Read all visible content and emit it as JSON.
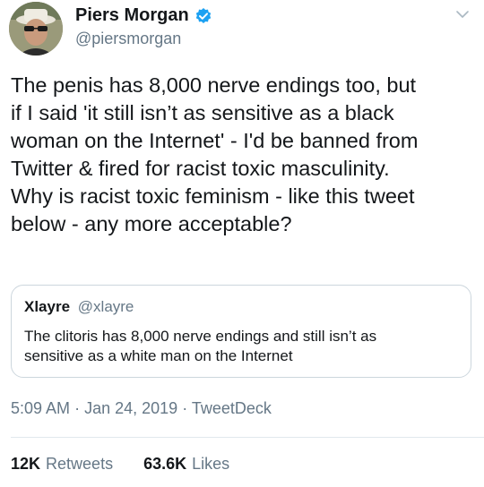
{
  "author": {
    "display_name": "Piers Morgan",
    "handle": "@piersmorgan",
    "verified_icon": "verified-badge-icon",
    "accent": "#1da1f2"
  },
  "tweet": {
    "text": "The penis has 8,000 nerve endings too, but\nif I said 'it still isn’t as sensitive as a black\nwoman on the Internet' - I'd be banned from\nTwitter & fired for racist toxic masculinity.\nWhy is racist toxic feminism - like this tweet\nbelow - any more acceptable?"
  },
  "quoted_tweet": {
    "display_name": "Xlayre",
    "handle": "@xlayre",
    "text": "The clitoris has 8,000 nerve endings and still isn’t as\nsensitive as a white man on the Internet"
  },
  "meta": {
    "time": "5:09 AM",
    "separator1": "·",
    "date": "Jan 24, 2019",
    "separator2": "·",
    "client": "TweetDeck"
  },
  "stats": {
    "retweets_count": "12K",
    "retweets_label": "Retweets",
    "likes_count": "63.6K",
    "likes_label": "Likes"
  }
}
